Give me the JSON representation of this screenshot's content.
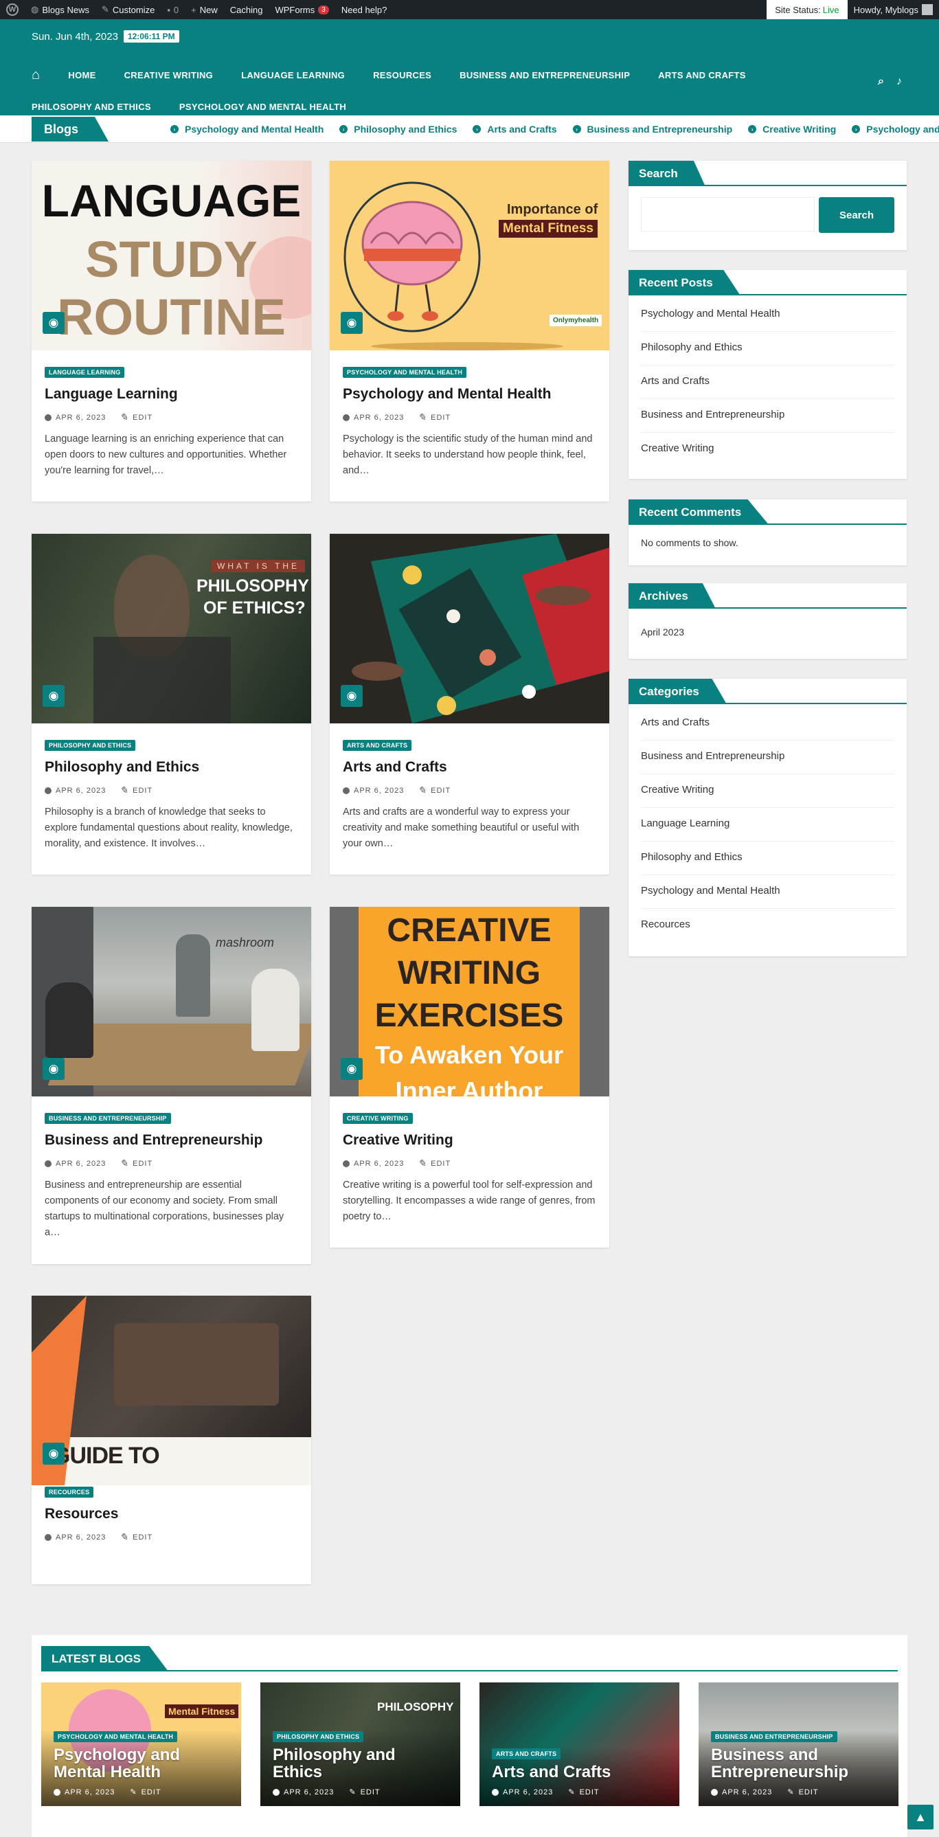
{
  "adminbar": {
    "site_name": "Blogs News",
    "customize": "Customize",
    "comments_count": "0",
    "new": "New",
    "caching": "Caching",
    "wpforms": "WPForms",
    "wpforms_count": "3",
    "help": "Need help?",
    "site_status_label": "Site Status:",
    "site_status_value": "Live",
    "howdy": "Howdy, Myblogs"
  },
  "header": {
    "date": "Sun. Jun 4th, 2023",
    "time": "12:06:11 PM",
    "nav": [
      "Home",
      "Creative Writing",
      "Language Learning",
      "Resources",
      "Business and Entrepreneurship",
      "Arts and Crafts",
      "Philosophy and Ethics",
      "Psychology and Mental Health"
    ]
  },
  "ticker": {
    "label": "Blogs",
    "items": [
      "Psychology and Mental Health",
      "Philosophy and Ethics",
      "Arts and Crafts",
      "Business and Entrepreneurship",
      "Creative Writing",
      "Psychology and Me"
    ]
  },
  "posts": [
    {
      "badge": "Language Learning",
      "title": "Language Learning",
      "date": "Apr 6, 2023",
      "edit": "Edit",
      "excerpt": "Language learning is an enriching experience that can open doors to new cultures and opportunities. Whether you're learning for travel,…",
      "img_lines": [
        "LANGUAGE",
        "STUDY",
        "ROUTINE"
      ]
    },
    {
      "badge": "Psychology and Mental Health",
      "title": "Psychology and Mental Health",
      "date": "Apr 6, 2023",
      "edit": "Edit",
      "excerpt": "Psychology is the scientific study of the human mind and behavior. It seeks to understand how people think, feel, and…",
      "img_lines": [
        "Importance of",
        "Mental Fitness",
        "Onlymyhealth"
      ]
    },
    {
      "badge": "Philosophy and Ethics",
      "title": "Philosophy and Ethics",
      "date": "Apr 6, 2023",
      "edit": "Edit",
      "excerpt": "Philosophy is a branch of knowledge that seeks to explore fundamental questions about reality, knowledge, morality, and existence. It involves…",
      "img_lines": [
        "WHAT IS THE",
        "PHILOSOPHY",
        "OF ETHICS?"
      ]
    },
    {
      "badge": "Arts and Crafts",
      "title": "Arts and Crafts",
      "date": "Apr 6, 2023",
      "edit": "Edit",
      "excerpt": "Arts and crafts are a wonderful way to express your creativity and make something beautiful or useful with your own…",
      "img_lines": []
    },
    {
      "badge": "Business and Entrepreneurship",
      "title": "Business and Entrepreneurship",
      "date": "Apr 6, 2023",
      "edit": "Edit",
      "excerpt": "Business and entrepreneurship are essential components of our economy and society. From small startups to multinational corporations, businesses play a…",
      "img_lines": [
        "mashroom"
      ]
    },
    {
      "badge": "Creative Writing",
      "title": "Creative Writing",
      "date": "Apr 6, 2023",
      "edit": "Edit",
      "excerpt": "Creative writing is a powerful tool for self-expression and storytelling. It encompasses a wide range of genres, from poetry to…",
      "img_lines": [
        "CREATIVE",
        "WRITING",
        "EXERCISES",
        "To Awaken Your",
        "Inner Author"
      ]
    },
    {
      "badge": "Recources",
      "title": "Resources",
      "date": "Apr 6, 2023",
      "edit": "Edit",
      "excerpt": "",
      "img_lines": [
        "GUIDE TO"
      ]
    }
  ],
  "sidebar": {
    "search_title": "Search",
    "search_button": "Search",
    "search_placeholder": "",
    "recent_posts_title": "Recent Posts",
    "recent_posts": [
      "Psychology and Mental Health",
      "Philosophy and Ethics",
      "Arts and Crafts",
      "Business and Entrepreneurship",
      "Creative Writing"
    ],
    "recent_comments_title": "Recent Comments",
    "recent_comments_empty": "No comments to show.",
    "archives_title": "Archives",
    "archives": [
      "April 2023"
    ],
    "categories_title": "Categories",
    "categories": [
      "Arts and Crafts",
      "Business and Entrepreneurship",
      "Creative Writing",
      "Language Learning",
      "Philosophy and Ethics",
      "Psychology and Mental Health",
      "Recources"
    ]
  },
  "latest": {
    "title": "LATEST BLOGS",
    "items": [
      {
        "badge": "Psychology and Mental Health",
        "title": "Psychology and Mental Health",
        "date": "Apr 6, 2023",
        "edit": "Edit"
      },
      {
        "badge": "Philosophy and Ethics",
        "title": "Philosophy and Ethics",
        "date": "Apr 6, 2023",
        "edit": "Edit"
      },
      {
        "badge": "Arts and Crafts",
        "title": "Arts and Crafts",
        "date": "Apr 6, 2023",
        "edit": "Edit"
      },
      {
        "badge": "Business and Entrepreneurship",
        "title": "Business and Entrepreneurship",
        "date": "Apr 6, 2023",
        "edit": "Edit"
      }
    ]
  },
  "colors": {
    "brand": "#0a8181",
    "adminbar": "#1d2327",
    "page_bg": "#eeeeee"
  }
}
